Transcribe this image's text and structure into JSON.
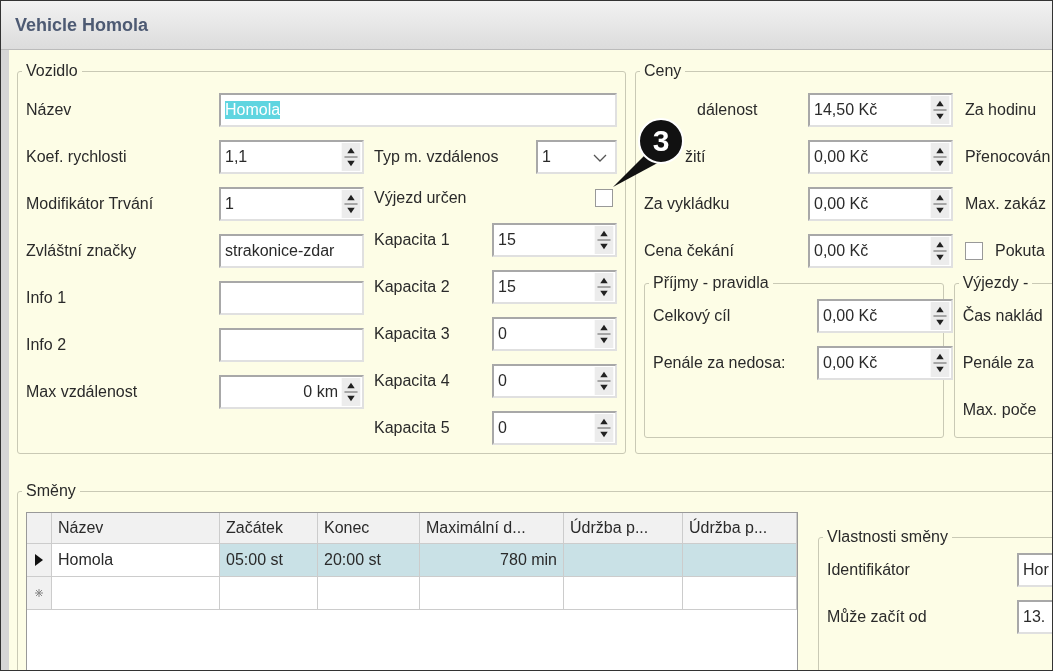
{
  "window": {
    "title": "Vehicle Homola"
  },
  "vehicle": {
    "legend": "Vozidlo",
    "name": {
      "label": "Název",
      "value": "Homola",
      "text_selected": true
    },
    "fields": [
      {
        "label": "Koef. rychlosti",
        "value": "1,1",
        "kind": "spin"
      },
      {
        "label": "Modifikátor Trvání",
        "value": "1",
        "kind": "spin"
      },
      {
        "label": "Zvláštní značky",
        "value": "strakonice-zdar",
        "kind": "text"
      },
      {
        "label": "Info 1",
        "kind": "text"
      },
      {
        "label": "Info 2",
        "kind": "text"
      },
      {
        "label": "Max vzdálenost",
        "value": "0 km",
        "kind": "spin_right"
      }
    ],
    "distance_type": {
      "label": "Typ m. vzdálenos",
      "value": "1"
    },
    "departure_fixed": {
      "label": "Výjezd určen",
      "checked": false
    },
    "capacities": [
      {
        "label": "Kapacita 1",
        "value": "15"
      },
      {
        "label": "Kapacita 2",
        "value": "15"
      },
      {
        "label": "Kapacita 3",
        "value": "0"
      },
      {
        "label": "Kapacita 4",
        "value": "0"
      },
      {
        "label": "Kapacita 5",
        "value": "0"
      }
    ]
  },
  "prices": {
    "legend": "Ceny",
    "rows": [
      {
        "label": "dálenost",
        "value": "14,50 Kč",
        "covered": true
      },
      {
        "label": "žití",
        "value": "0,00 Kč",
        "covered": true
      },
      {
        "label": "Za vykládku",
        "value": "0,00 Kč"
      },
      {
        "label": "Cena čekání",
        "value": "0,00 Kč"
      }
    ],
    "side": [
      {
        "label": "Za hodinu",
        "kind": "text"
      },
      {
        "label": "Přenocován",
        "kind": "text"
      },
      {
        "label": "Max. zakáz",
        "kind": "text"
      },
      {
        "label": "Pokuta",
        "kind": "checkbox",
        "checked": false
      }
    ],
    "income": {
      "legend": "Příjmy - pravidla",
      "rows": [
        {
          "label": "Celkový cíl",
          "value": "0,00 Kč"
        },
        {
          "label": "Penále za nedosa:",
          "value": "0,00 Kč"
        }
      ]
    },
    "departures": {
      "legend": "Výjezdy -",
      "labels": [
        "Čas naklád",
        "Penále za",
        "Max. poče"
      ]
    }
  },
  "shifts": {
    "legend": "Směny",
    "columns": [
      "Název",
      "Začátek",
      "Konec",
      "Maximální d...",
      "Údržba p...",
      "Údržba p..."
    ],
    "rows": [
      {
        "selected": true,
        "cells": [
          "Homola",
          "05:00 st",
          "20:00 st",
          "780 min",
          "",
          ""
        ]
      }
    ],
    "properties": {
      "legend": "Vlastnosti směny",
      "rows": [
        {
          "label": "Identifikátor",
          "value": "Hor"
        },
        {
          "label": "Může začít od",
          "value": "13."
        }
      ]
    }
  },
  "callout": {
    "number": "3"
  }
}
